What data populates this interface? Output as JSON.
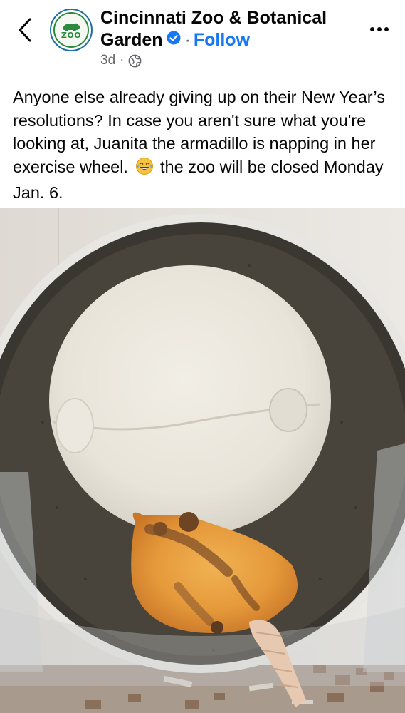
{
  "header": {
    "back_icon": "chevron-left-icon",
    "avatar_label": "ZOO",
    "page_name_line1": "Cincinnati Zoo & Botanical",
    "page_name_line2": "Garden",
    "verified_icon": "verified-badge-icon",
    "separator": "·",
    "follow_label": "Follow",
    "timestamp": "3d",
    "meta_separator": "·",
    "audience_icon": "globe-icon",
    "more_icon": "more-options-icon"
  },
  "post": {
    "text_part1": "Anyone else already giving up on their New Year’s resolutions? In case you aren't sure what you're looking at, Juanita the armadillo is napping in her exercise wheel.",
    "emoji_icon": "face-with-tears-of-joy-icon",
    "text_part2": "the zoo will be closed Monday Jan. 6."
  },
  "colors": {
    "link_blue": "#1877f2",
    "verified_blue": "#1877f2",
    "meta_gray": "#65676b",
    "text": "#050505"
  }
}
